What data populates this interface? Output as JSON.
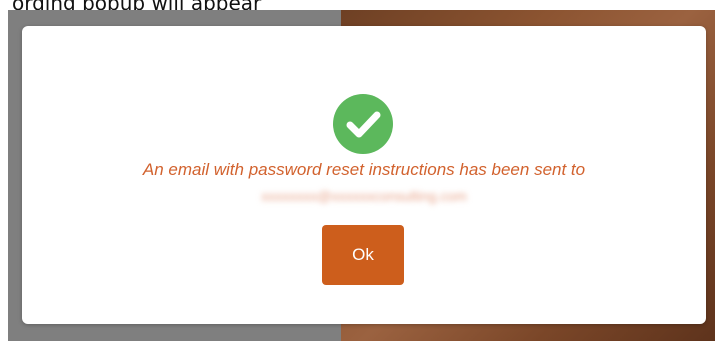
{
  "top_caption": "ording popup will appear",
  "dialog": {
    "message": "An email with password reset instructions has been sent to",
    "email": "xxxxxxxx@xxxxxxconsulting.com",
    "ok_label": "Ok"
  },
  "colors": {
    "accent": "#cd5e1c",
    "message_text": "#d2622e",
    "success": "#5cb85c"
  },
  "icons": {
    "status": "check-circle-icon"
  }
}
